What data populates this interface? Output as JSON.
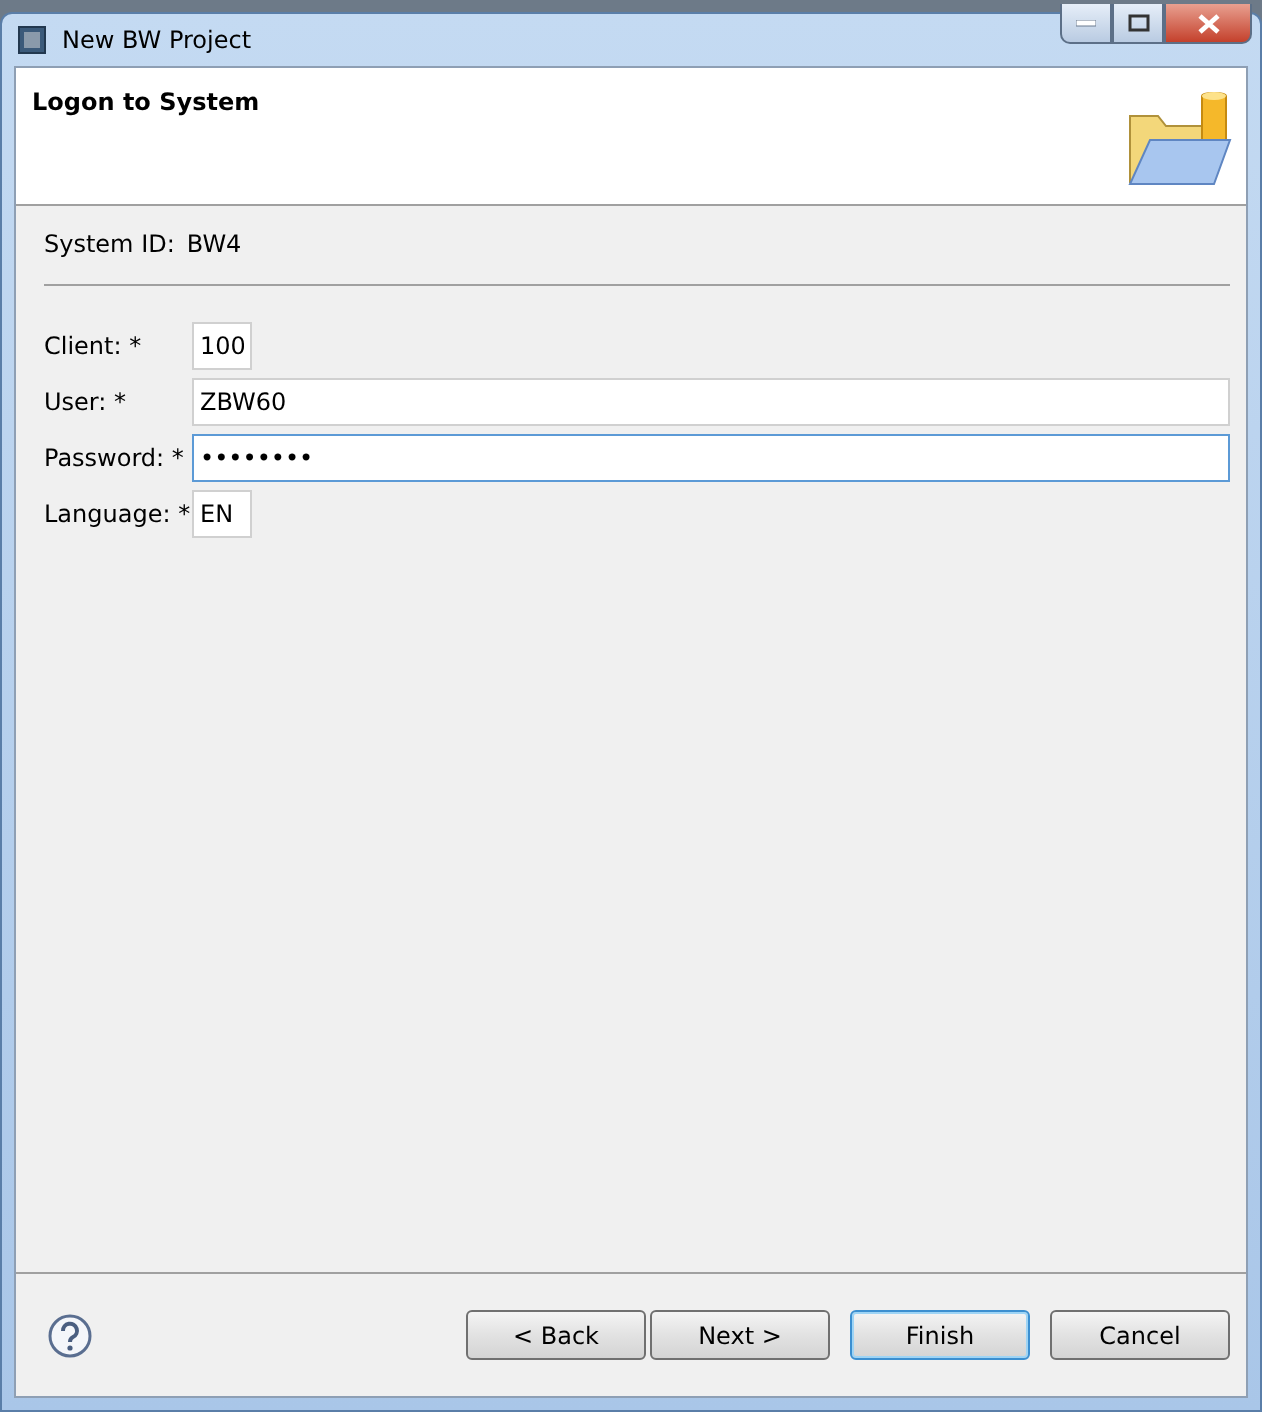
{
  "window": {
    "title": "New BW Project"
  },
  "header": {
    "title": "Logon to System"
  },
  "system_id": {
    "label": "System ID:",
    "value": "BW4"
  },
  "fields": [
    {
      "label": "Client: *",
      "value": "100",
      "kind": "short",
      "focused": false
    },
    {
      "label": "User: *",
      "value": "ZBW60",
      "kind": "wide",
      "focused": false
    },
    {
      "label": "Password: *",
      "value": "••••••••",
      "kind": "wide",
      "focused": true
    },
    {
      "label": "Language: *",
      "value": "EN",
      "kind": "short",
      "focused": false
    }
  ],
  "buttons": [
    {
      "label": "< Back",
      "default": false
    },
    {
      "label": "Next >",
      "default": false
    },
    {
      "label": "Finish",
      "default": true
    },
    {
      "label": "Cancel",
      "default": false
    }
  ]
}
